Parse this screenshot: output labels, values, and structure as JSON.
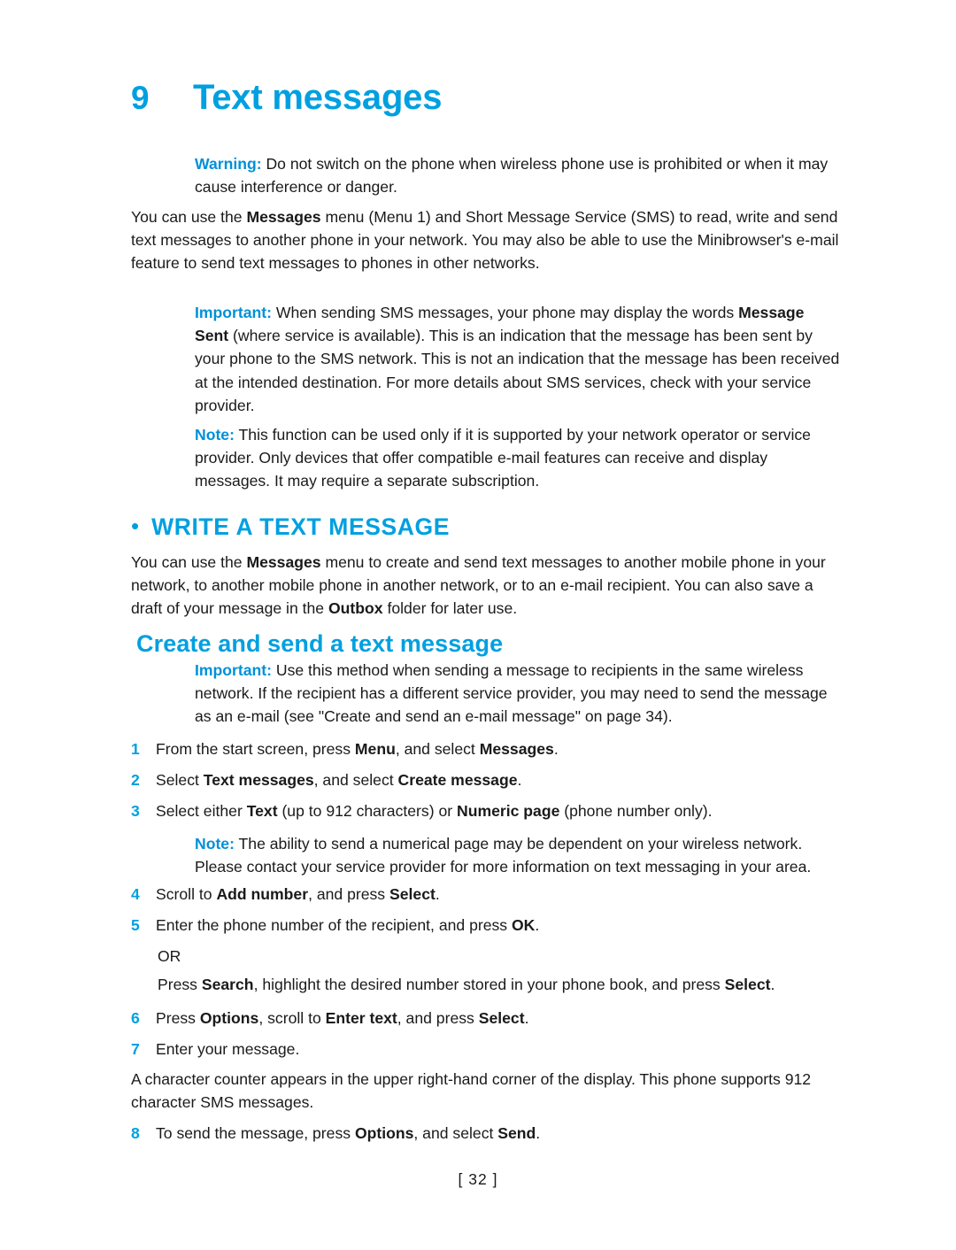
{
  "chapter": {
    "number": "9",
    "title": "Text messages"
  },
  "warning_para": {
    "lead": "Warning:",
    "text": " Do not switch on the phone when wireless phone use is prohibited or when it may cause interference or danger."
  },
  "intro_para": {
    "part1": "You can use the ",
    "bold1": "Messages",
    "part2": " menu (Menu 1) and Short Message Service (SMS) to read, write and send text messages to another phone in your network. You may also be able to use the Minibrowser's e-mail feature to send text messages to phones in other networks."
  },
  "important_para": {
    "lead": "Important:",
    "part1": " When sending SMS messages, your phone may display the words ",
    "bold1": "Message Sent",
    "part2": " (where service is available). This is an indication that the message has been sent by your phone to the SMS network. This is not an indication that the message has been received at the intended destination. For more details about SMS services, check with your service provider."
  },
  "note_para": {
    "lead": "Note:",
    "text": " This function can be used only if it is supported by your network operator or service provider. Only devices that offer compatible e-mail features can receive and display messages. It may require a separate subscription."
  },
  "section": {
    "bullet": "•",
    "title": "WRITE A TEXT MESSAGE"
  },
  "section_para": {
    "part1": "You can use the ",
    "bold1": "Messages",
    "part2": " menu to create and send text messages to another mobile phone in your network, to another mobile phone in another network, or to an e-mail recipient. You can also save a draft of your message in the ",
    "bold2": "Outbox",
    "part3": " folder for later use."
  },
  "subsection": {
    "title": "Create and send a text message"
  },
  "important2_para": {
    "lead": "Important:",
    "text": " Use this method when sending a message to recipients in the same wireless network. If the recipient has a different service provider, you may need to send the message as an e-mail (see \"Create and send an e-mail message\" on page 34)."
  },
  "steps": [
    {
      "num": "1",
      "segments": [
        {
          "t": "From the start screen, press ",
          "b": false
        },
        {
          "t": "Menu",
          "b": true
        },
        {
          "t": ", and select ",
          "b": false
        },
        {
          "t": "Messages",
          "b": true
        },
        {
          "t": ".",
          "b": false
        }
      ]
    },
    {
      "num": "2",
      "segments": [
        {
          "t": "Select ",
          "b": false
        },
        {
          "t": "Text messages",
          "b": true
        },
        {
          "t": ", and select ",
          "b": false
        },
        {
          "t": "Create message",
          "b": true
        },
        {
          "t": ".",
          "b": false
        }
      ]
    },
    {
      "num": "3",
      "segments": [
        {
          "t": "Select either ",
          "b": false
        },
        {
          "t": "Text",
          "b": true
        },
        {
          "t": " (up to 912 characters) or ",
          "b": false
        },
        {
          "t": "Numeric page",
          "b": true
        },
        {
          "t": " (phone number only).",
          "b": false
        }
      ]
    }
  ],
  "note2_para": {
    "lead": "Note:",
    "text": " The ability to send a numerical page may be dependent on your wireless network. Please contact your service provider for more information on text messaging in your area."
  },
  "steps2": [
    {
      "num": "4",
      "segments": [
        {
          "t": "Scroll to ",
          "b": false
        },
        {
          "t": "Add number",
          "b": true
        },
        {
          "t": ", and press ",
          "b": false
        },
        {
          "t": "Select",
          "b": true
        },
        {
          "t": ".",
          "b": false
        }
      ]
    },
    {
      "num": "5",
      "segments": [
        {
          "t": "Enter the phone number of the recipient, and press ",
          "b": false
        },
        {
          "t": "OK",
          "b": true
        },
        {
          "t": ".",
          "b": false
        }
      ]
    }
  ],
  "or_text": "OR",
  "search_para": {
    "segments": [
      {
        "t": "Press ",
        "b": false
      },
      {
        "t": "Search",
        "b": true
      },
      {
        "t": ", highlight the desired number stored in your phone book, and press ",
        "b": false
      },
      {
        "t": "Select",
        "b": true
      },
      {
        "t": ".",
        "b": false
      }
    ]
  },
  "steps3": [
    {
      "num": "6",
      "segments": [
        {
          "t": "Press ",
          "b": false
        },
        {
          "t": "Options",
          "b": true
        },
        {
          "t": ", scroll to ",
          "b": false
        },
        {
          "t": "Enter text",
          "b": true
        },
        {
          "t": ", and press ",
          "b": false
        },
        {
          "t": "Select",
          "b": true
        },
        {
          "t": ".",
          "b": false
        }
      ]
    },
    {
      "num": "7",
      "segments": [
        {
          "t": "Enter your message.",
          "b": false
        }
      ]
    }
  ],
  "counter_para": {
    "text": "A character counter appears in the upper right-hand corner of the display. This phone supports 912 character SMS messages."
  },
  "steps4": [
    {
      "num": "8",
      "segments": [
        {
          "t": "To send the message, press ",
          "b": false
        },
        {
          "t": "Options",
          "b": true
        },
        {
          "t": ", and select ",
          "b": false
        },
        {
          "t": "Send",
          "b": true
        },
        {
          "t": ".",
          "b": false
        }
      ]
    }
  ],
  "footer": {
    "page": "[ 32 ]"
  },
  "colors": {
    "accent": "#00a0e0",
    "text": "#1a1a1a",
    "background": "#ffffff"
  }
}
